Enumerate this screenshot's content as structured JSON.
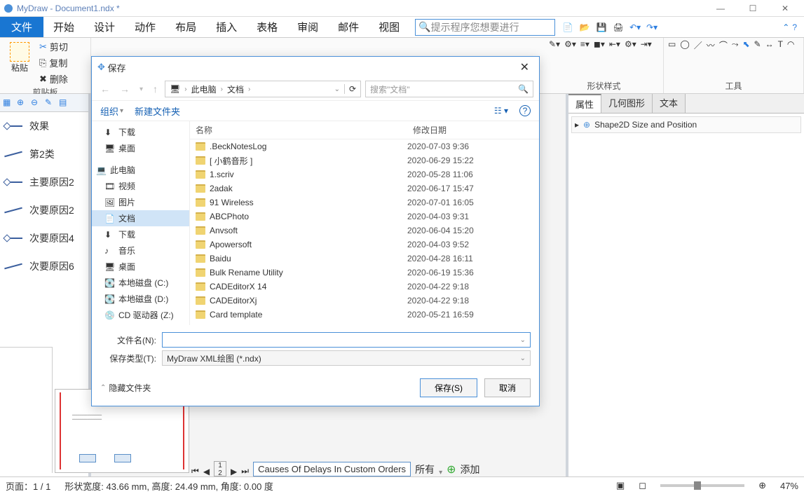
{
  "window": {
    "title": "MyDraw - Document1.ndx *"
  },
  "menus": {
    "file": "文件",
    "items": [
      "开始",
      "设计",
      "动作",
      "布局",
      "插入",
      "表格",
      "审阅",
      "邮件",
      "视图"
    ],
    "search_placeholder": "提示程序您想要进行"
  },
  "clipboard": {
    "paste": "粘贴",
    "cut": "剪切",
    "copy": "复制",
    "delete": "删除",
    "group_label": "剪贴板"
  },
  "right_section_labels": {
    "shape_style": "形状样式",
    "tools": "工具"
  },
  "shapes": [
    "效果",
    "第2类",
    "主要原因2",
    "次要原因2",
    "次要原因4",
    "次要原因6"
  ],
  "right_tabs": {
    "props": "属性",
    "geom": "几何图形",
    "text": "文本"
  },
  "right_prop": "Shape2D Size and Position",
  "page_tab": "Causes Of Delays In Custom Orders",
  "page_tools": {
    "all": "所有",
    "add": "添加"
  },
  "status": {
    "page": "页面：1 / 1",
    "shape": "形状宽度: 43.66 mm, 高度: 24.49 mm, 角度: 0.00 度",
    "zoom": "47%"
  },
  "dialog": {
    "title": "保存",
    "crumbs": [
      "此电脑",
      "文档"
    ],
    "search_placeholder": "搜索\"文档\"",
    "organize": "组织",
    "new_folder": "新建文件夹",
    "col_name": "名称",
    "col_date": "修改日期",
    "tree": [
      {
        "label": "下载",
        "icon": "download"
      },
      {
        "label": "桌面",
        "icon": "desktop"
      },
      {
        "label": "此电脑",
        "icon": "pc",
        "bold": true
      },
      {
        "label": "视频",
        "icon": "video"
      },
      {
        "label": "图片",
        "icon": "image"
      },
      {
        "label": "文档",
        "icon": "doc",
        "selected": true
      },
      {
        "label": "下载",
        "icon": "download2"
      },
      {
        "label": "音乐",
        "icon": "music"
      },
      {
        "label": "桌面",
        "icon": "desktop"
      },
      {
        "label": "本地磁盘 (C:)",
        "icon": "disk"
      },
      {
        "label": "本地磁盘 (D:)",
        "icon": "disk"
      },
      {
        "label": "CD 驱动器 (Z:)",
        "icon": "cd"
      }
    ],
    "files": [
      {
        "name": ".BeckNotesLog",
        "date": "2020-07-03 9:36"
      },
      {
        "name": "[ 小鹤音形 ]",
        "date": "2020-06-29 15:22"
      },
      {
        "name": "1.scriv",
        "date": "2020-05-28 11:06"
      },
      {
        "name": "2adak",
        "date": "2020-06-17 15:47"
      },
      {
        "name": "91 Wireless",
        "date": "2020-07-01 16:05"
      },
      {
        "name": "ABCPhoto",
        "date": "2020-04-03 9:31"
      },
      {
        "name": "Anvsoft",
        "date": "2020-06-04 15:20"
      },
      {
        "name": "Apowersoft",
        "date": "2020-04-03 9:52"
      },
      {
        "name": "Baidu",
        "date": "2020-04-28 16:11"
      },
      {
        "name": "Bulk Rename Utility",
        "date": "2020-06-19 15:36"
      },
      {
        "name": "CADEditorX 14",
        "date": "2020-04-22 9:18"
      },
      {
        "name": "CADEditorXj",
        "date": "2020-04-22 9:18"
      },
      {
        "name": "Card template",
        "date": "2020-05-21 16:59"
      }
    ],
    "field_name_label": "文件名(N):",
    "field_type_label": "保存类型(T):",
    "field_type_value": "MyDraw XML绘图 (*.ndx)",
    "hide_folders": "隐藏文件夹",
    "save_btn": "保存(S)",
    "cancel_btn": "取消"
  }
}
